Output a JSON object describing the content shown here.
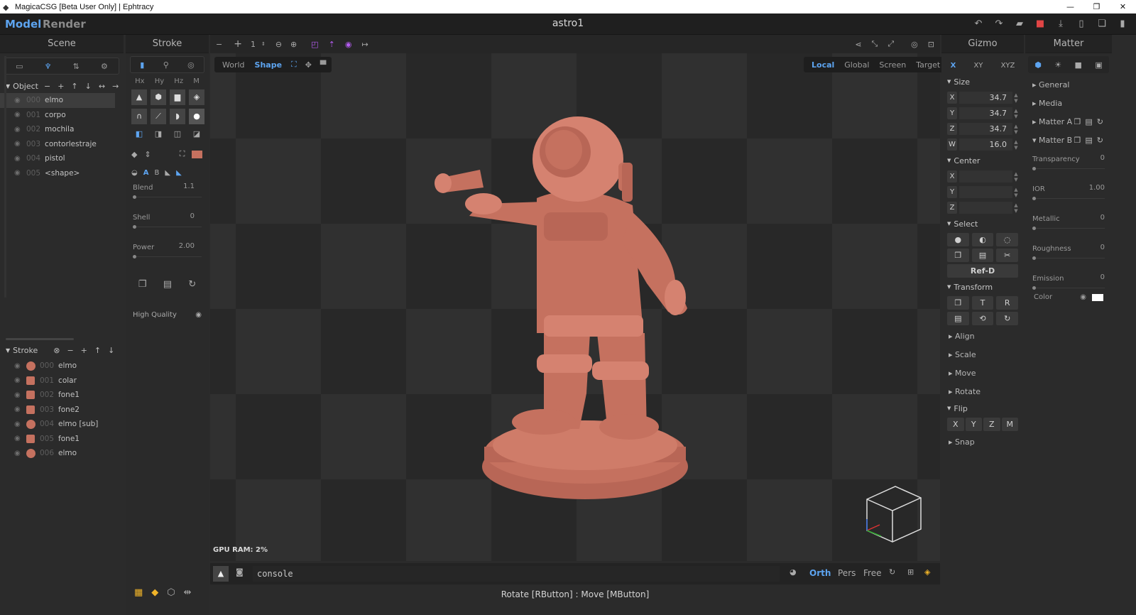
{
  "titlebar": {
    "title": "MagicaCSG [Beta User Only] | Ephtracy"
  },
  "menu": {
    "model": "Model",
    "render": "Render",
    "project": "astro1"
  },
  "scene": {
    "title": "Scene",
    "object_label": "Object",
    "objects": [
      {
        "idx": "000",
        "name": "elmo"
      },
      {
        "idx": "001",
        "name": "corpo"
      },
      {
        "idx": "002",
        "name": "mochila"
      },
      {
        "idx": "003",
        "name": "contorlestraje"
      },
      {
        "idx": "004",
        "name": "pistol"
      },
      {
        "idx": "005",
        "name": "<shape>"
      }
    ],
    "stroke_label": "Stroke",
    "strokes": [
      {
        "idx": "000",
        "name": "elmo",
        "shape": "sphere"
      },
      {
        "idx": "001",
        "name": "colar",
        "shape": "cylinder"
      },
      {
        "idx": "002",
        "name": "fone1",
        "shape": "cylinder"
      },
      {
        "idx": "003",
        "name": "fone2",
        "shape": "cylinder"
      },
      {
        "idx": "004",
        "name": "elmo [sub]",
        "shape": "sphere"
      },
      {
        "idx": "005",
        "name": "fone1",
        "shape": "cylinder"
      },
      {
        "idx": "006",
        "name": "elmo",
        "shape": "sphere"
      }
    ]
  },
  "stroke": {
    "title": "Stroke",
    "axes": [
      "Hx",
      "Hy",
      "Hz",
      "M"
    ],
    "blend_label": "Blend",
    "blend_value": "1.1",
    "shell_label": "Shell",
    "shell_value": "0",
    "power_label": "Power",
    "power_value": "2.00",
    "ab": [
      "A",
      "B"
    ],
    "high_quality": "High Quality"
  },
  "viewport": {
    "step": "1",
    "space_tabs": [
      {
        "label": "World",
        "on": false
      },
      {
        "label": "Shape",
        "on": true
      }
    ],
    "coord_tabs": [
      {
        "label": "Local",
        "on": true
      },
      {
        "label": "Global",
        "on": false
      },
      {
        "label": "Screen",
        "on": false
      },
      {
        "label": "Target",
        "on": false
      }
    ],
    "gpu": "GPU RAM:  2%",
    "console": "console",
    "view_modes": [
      {
        "label": "Orth",
        "on": true
      },
      {
        "label": "Pers",
        "on": false
      },
      {
        "label": "Free",
        "on": false
      }
    ],
    "status": "Rotate [RButton] : Move [MButton]",
    "model_color": "#c5715f"
  },
  "gizmo": {
    "title": "Gizmo",
    "tabs": [
      "X",
      "XY",
      "XYZ"
    ],
    "size_label": "Size",
    "size": [
      {
        "ax": "X",
        "v": "34.7"
      },
      {
        "ax": "Y",
        "v": "34.7"
      },
      {
        "ax": "Z",
        "v": "34.7"
      },
      {
        "ax": "W",
        "v": "16.0"
      }
    ],
    "center_label": "Center",
    "center": [
      {
        "ax": "X",
        "v": ""
      },
      {
        "ax": "Y",
        "v": ""
      },
      {
        "ax": "Z",
        "v": ""
      }
    ],
    "select_label": "Select",
    "refd": "Ref-D",
    "transform_label": "Transform",
    "t": "T",
    "r": "R",
    "align": "Align",
    "scale": "Scale",
    "move": "Move",
    "rotate": "Rotate",
    "flip_label": "Flip",
    "flip": [
      "X",
      "Y",
      "Z",
      "M"
    ],
    "snap": "Snap"
  },
  "matter": {
    "title": "Matter",
    "general": "General",
    "media": "Media",
    "matter_a": "Matter A",
    "matter_b": "Matter B",
    "props": [
      {
        "label": "Transparency",
        "v": "0"
      },
      {
        "label": "IOR",
        "v": "1.00"
      },
      {
        "label": "Metallic",
        "v": "0"
      },
      {
        "label": "Roughness",
        "v": "0"
      },
      {
        "label": "Emission",
        "v": "0"
      }
    ],
    "color_label": "Color"
  }
}
